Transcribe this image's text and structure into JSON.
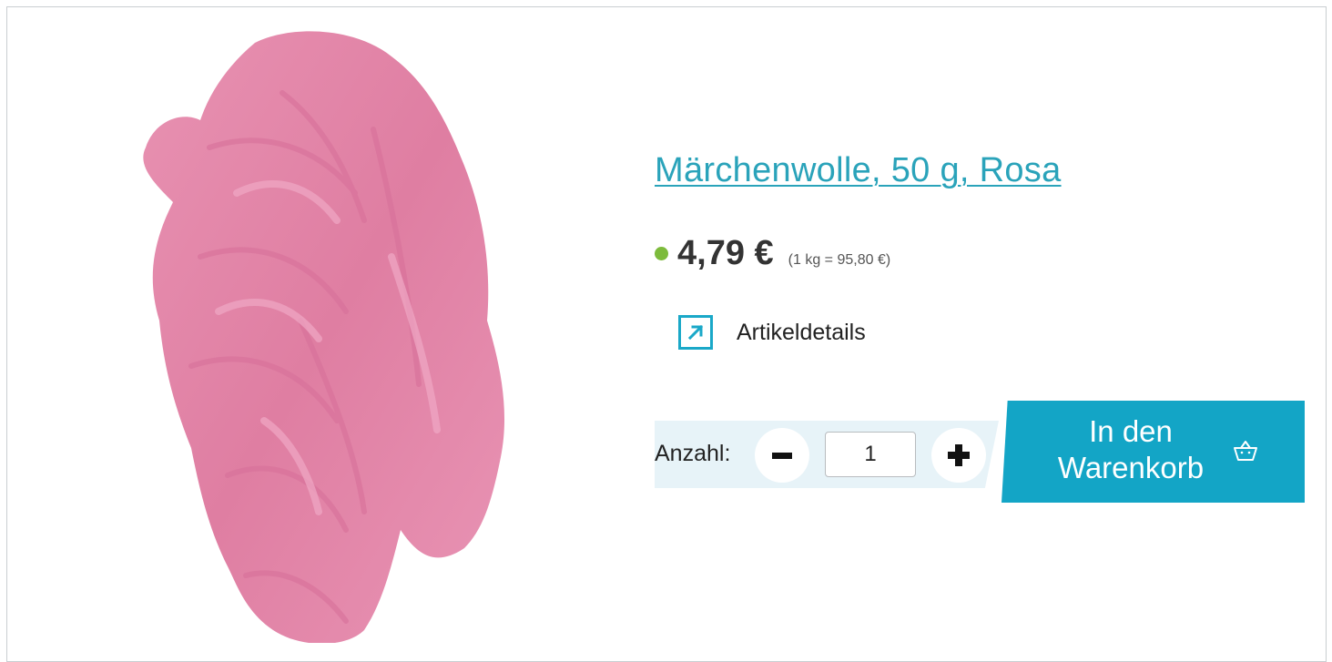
{
  "product": {
    "title": "Märchenwolle, 50 g, Rosa",
    "price": "4,79 €",
    "unit_price": "(1 kg = 95,80 €)",
    "availability_color": "#7dbb3c",
    "image_icon": "wool-product-image"
  },
  "details": {
    "label": "Artikeldetails",
    "icon": "external-link-icon"
  },
  "quantity": {
    "label": "Anzahl:",
    "value": "1",
    "minus_icon": "minus-icon",
    "plus_icon": "plus-icon"
  },
  "cart": {
    "line1": "In den",
    "line2": "Warenkorb",
    "icon": "basket-icon"
  },
  "colors": {
    "accent": "#13a5c6",
    "title": "#2aa3ba",
    "band": "#e7f3f8"
  }
}
